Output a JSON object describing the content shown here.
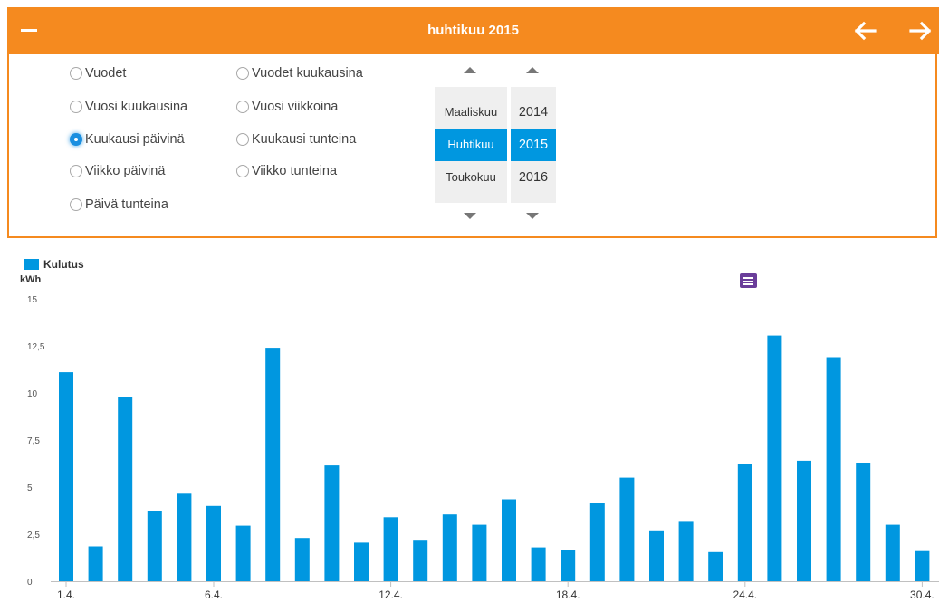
{
  "header": {
    "title": "huhtikuu 2015",
    "collapse_icon": "minus-icon",
    "prev_icon": "arrow-left-icon",
    "next_icon": "arrow-right-icon",
    "color": "#f58a1f"
  },
  "period_options": {
    "col1": [
      "Vuodet",
      "Vuosi kuukausina",
      "Kuukausi päivinä",
      "Viikko päivinä",
      "Päivä tunteina"
    ],
    "col2": [
      "Vuodet kuukausina",
      "Vuosi viikkoina",
      "Kuukausi tunteina",
      "Viikko tunteina"
    ],
    "selected": "Kuukausi päivinä"
  },
  "picker": {
    "months": [
      "Maaliskuu",
      "Huhtikuu",
      "Toukokuu"
    ],
    "years": [
      "2014",
      "2015",
      "2016"
    ],
    "selected_month": "Huhtikuu",
    "selected_year": "2015",
    "selection_color": "#0097e0"
  },
  "legend": {
    "label": "Kulutus",
    "color": "#0097e0"
  },
  "unit_label": "kWh",
  "export_icon": "document-icon",
  "chart_data": {
    "type": "bar",
    "series": [
      {
        "name": "Kulutus",
        "values": [
          11.1,
          1.85,
          9.8,
          3.75,
          4.65,
          4.0,
          2.95,
          12.4,
          2.3,
          6.15,
          2.05,
          3.4,
          2.2,
          3.55,
          3.0,
          4.35,
          1.8,
          1.65,
          4.15,
          5.5,
          2.7,
          3.2,
          1.55,
          6.2,
          13.05,
          6.4,
          11.9,
          6.3,
          3.0,
          1.6
        ]
      }
    ],
    "x": [
      "1.4.",
      "2.4.",
      "3.4.",
      "4.4.",
      "5.4.",
      "6.4.",
      "7.4.",
      "8.4.",
      "9.4.",
      "10.4.",
      "11.4.",
      "12.4.",
      "13.4.",
      "14.4.",
      "15.4.",
      "16.4.",
      "17.4.",
      "18.4.",
      "19.4.",
      "20.4.",
      "21.4.",
      "22.4.",
      "23.4.",
      "24.4.",
      "25.4.",
      "26.4.",
      "27.4.",
      "28.4.",
      "29.4.",
      "30.4."
    ],
    "xtick_labels": [
      "1.4.",
      "6.4.",
      "12.4.",
      "18.4.",
      "24.4.",
      "30.4."
    ],
    "yticks": [
      "0",
      "2,5",
      "5",
      "7,5",
      "10",
      "12,5",
      "15"
    ],
    "ylim": [
      0,
      15
    ],
    "ylabel": "kWh",
    "grid": false,
    "legend_position": "top-left",
    "color": "#0097e0"
  }
}
